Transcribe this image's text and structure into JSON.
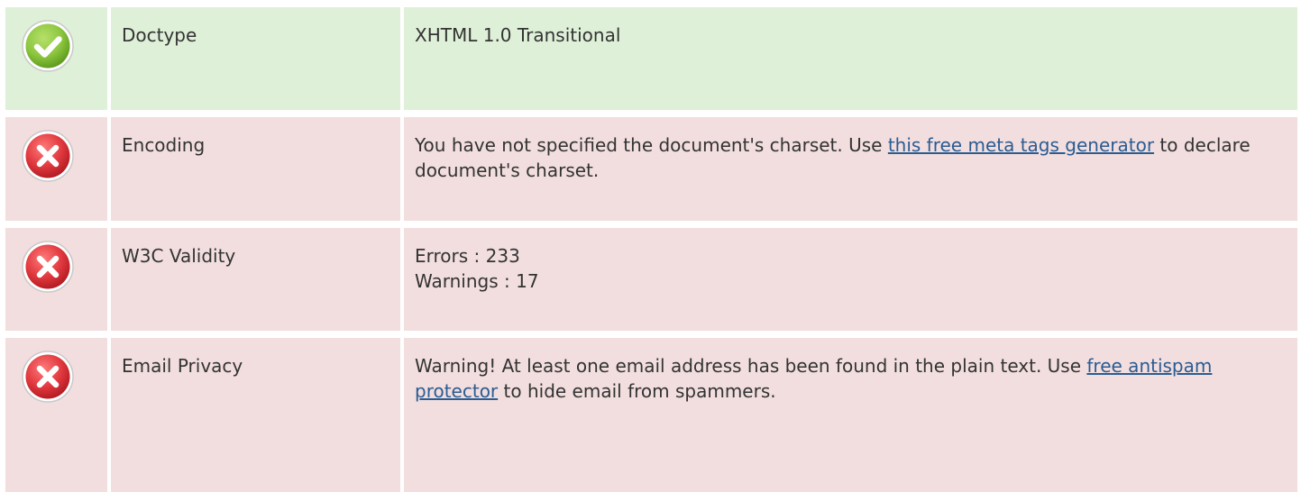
{
  "rows": [
    {
      "status": "pass",
      "status_icon": "check-circle-icon",
      "label": "Doctype",
      "value": "XHTML 1.0 Transitional"
    },
    {
      "status": "fail",
      "status_icon": "error-x-circle-icon",
      "label": "Encoding",
      "text_before": "You have not specified the document's charset. Use ",
      "link_text": "this free meta tags generator",
      "text_after": " to declare document's charset."
    },
    {
      "status": "fail",
      "status_icon": "error-x-circle-icon",
      "label": "W3C Validity",
      "errors": "Errors : 233",
      "warnings": "Warnings : 17"
    },
    {
      "status": "fail",
      "status_icon": "error-x-circle-icon",
      "label": "Email Privacy",
      "text_before": "Warning! At least one email address has been found in the plain text. Use ",
      "link_text": "free antispam protector",
      "text_after": " to hide email from spammers."
    }
  ],
  "colors": {
    "pass_bg": "#dff0d8",
    "fail_bg": "#f2dede",
    "pass_icon": "#8cc63f",
    "fail_icon": "#e0383e",
    "link": "#2a5c93"
  }
}
